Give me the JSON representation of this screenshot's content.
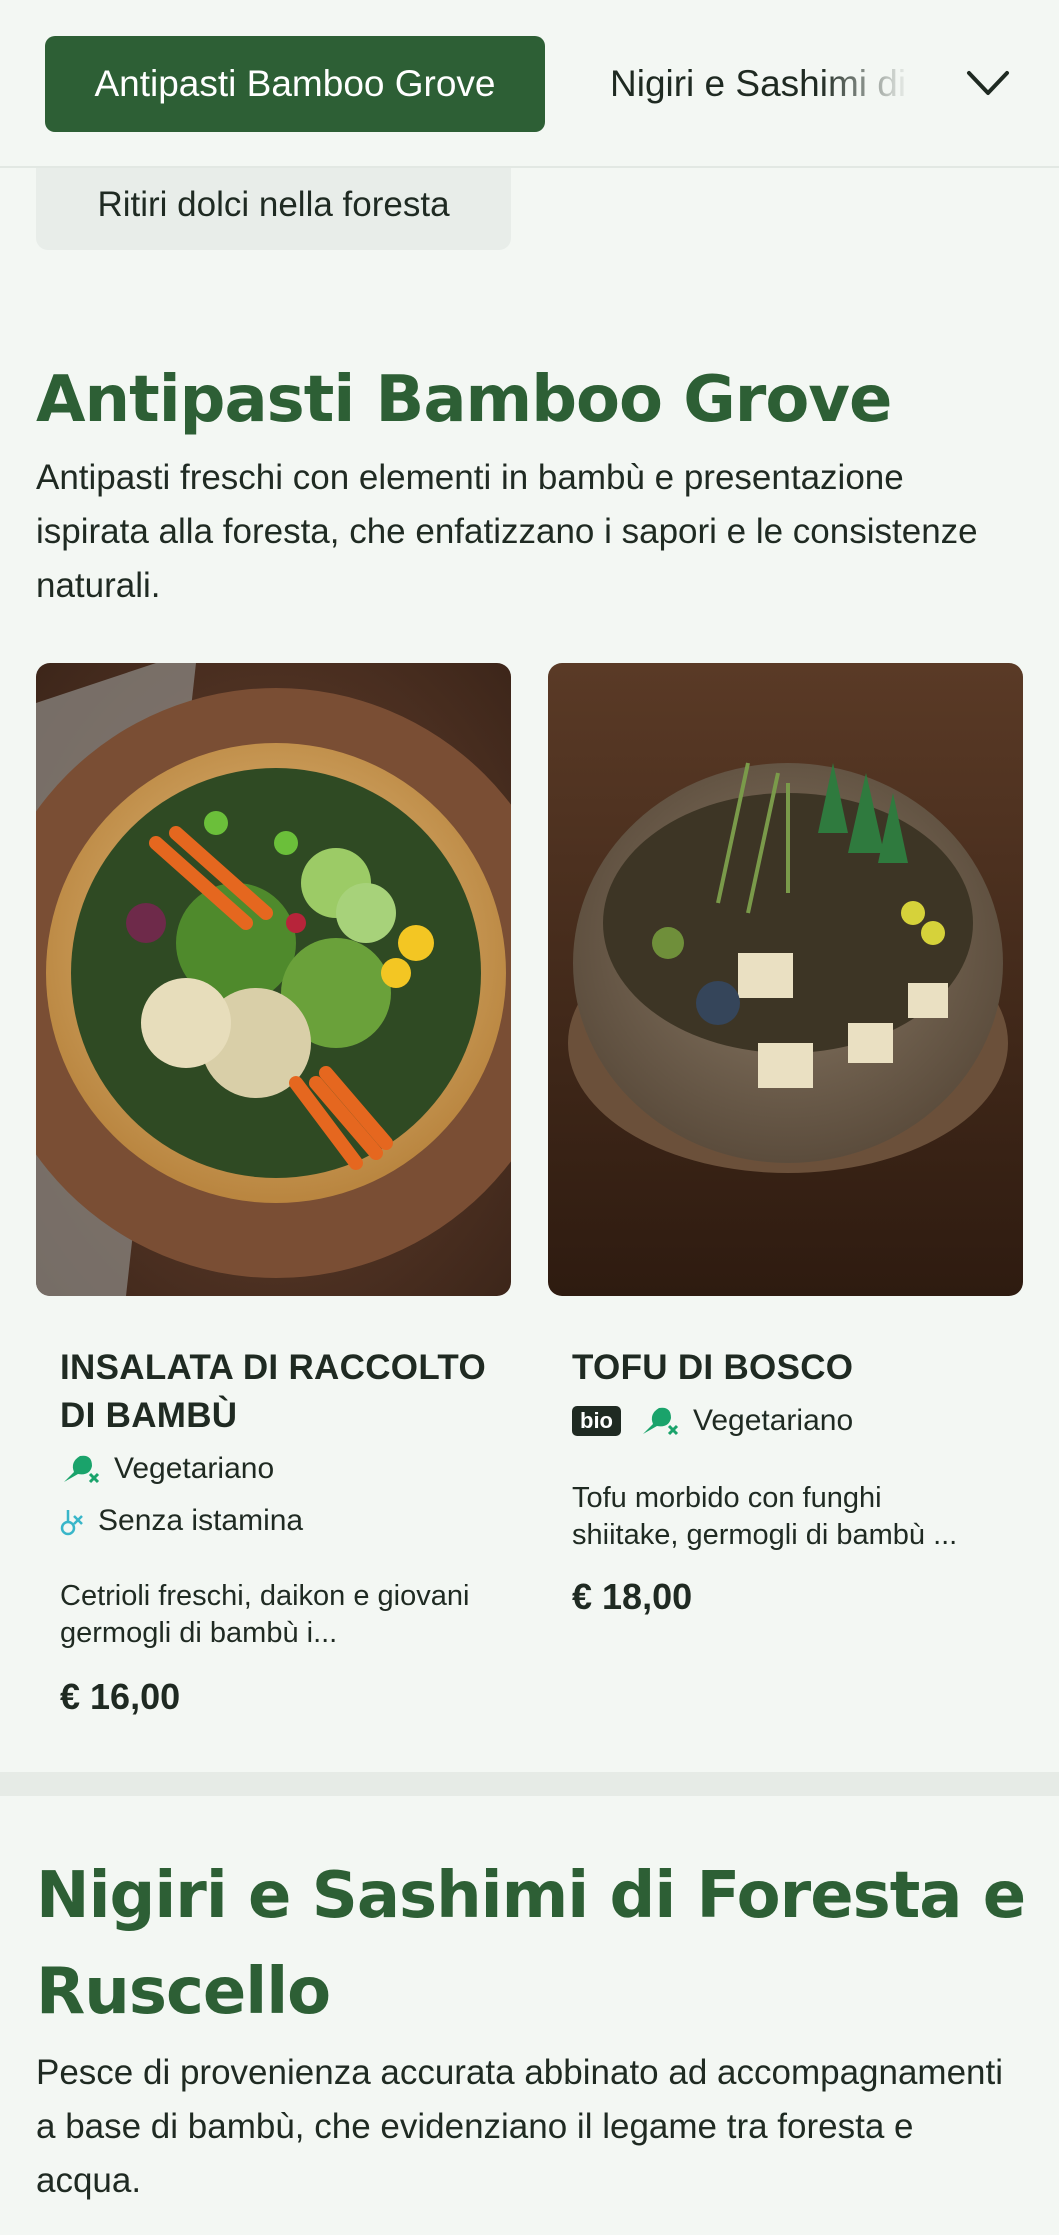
{
  "nav": {
    "active_tab": "Antipasti Bamboo Grove",
    "next_tab": "Nigiri e Sashimi di Foresta e Ruscello",
    "chip_label": "Ritiri dolci nella foresta",
    "chevron_icon": "chevron-down-icon"
  },
  "section1": {
    "title": "Antipasti Bamboo Grove",
    "description": "Antipasti freschi con elementi in bambù e presentazione ispirata alla foresta, che enfatizzano i sapori e le consistenze naturali."
  },
  "items": [
    {
      "name": "INSALATA DI RACCOLTO DI BAMBÙ",
      "tags": [
        "Vegetariano",
        "Senza istamina"
      ],
      "description": "Cetrioli freschi, daikon e giovani germogli di bambù i...",
      "price": "€ 16,00"
    },
    {
      "name": "TOFU DI BOSCO",
      "badge": "bio",
      "tags": [
        "Vegetariano"
      ],
      "description": "Tofu morbido con funghi shiitake, germogli di bambù ...",
      "price": "€ 18,00"
    }
  ],
  "section2": {
    "title": "Nigiri e Sashimi di Foresta e Ruscello",
    "description": "Pesce di provenienza accurata abbinato ad accompagnamenti a base di bambù, che evidenziano il legame tra foresta e acqua."
  },
  "colors": {
    "primary": "#2d5f35",
    "background": "#f3f7f3",
    "tag_icon": "#1aa36b",
    "tag_icon_light": "#38b6c9"
  }
}
